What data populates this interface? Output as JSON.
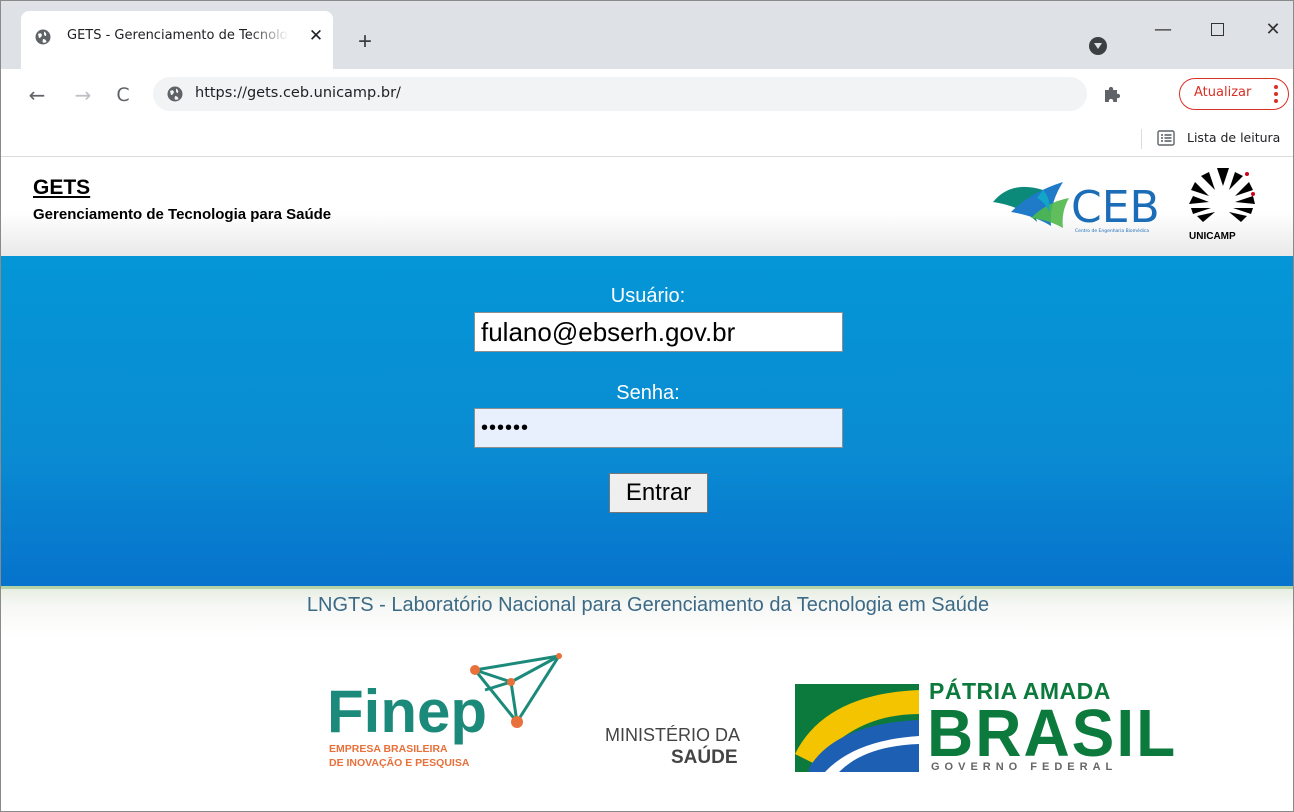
{
  "browser": {
    "tab": {
      "title": "GETS - Gerenciamento de Tecnologia para Saúde",
      "close": "✕"
    },
    "new_tab": "+",
    "window_controls": {
      "minimize": "—",
      "close": "✕"
    },
    "nav": {
      "back": "←",
      "forward": "→",
      "reload": "C"
    },
    "address": "https://gets.ceb.unicamp.br/",
    "update_button": "Atualizar",
    "reading_list": "Lista de leitura"
  },
  "header": {
    "title": "GETS",
    "subtitle": "Gerenciamento de Tecnologia para Saúde"
  },
  "login": {
    "user_label": "Usuário:",
    "user_value": "fulano@ebserh.gov.br",
    "password_label": "Senha:",
    "password_value": "••••••",
    "submit": "Entrar"
  },
  "footer": {
    "lab_text": "LNGTS - Laboratório Nacional para Gerenciamento da Tecnologia em Saúde",
    "logos": {
      "ceb": {
        "name": "CEB",
        "tagline": "Centro de Engenharia Biomédica"
      },
      "unicamp": "UNICAMP",
      "finep": {
        "name": "Finep",
        "line1": "EMPRESA BRASILEIRA",
        "line2": "DE INOVAÇÃO E PESQUISA"
      },
      "ministerio": {
        "line1": "MINISTÉRIO DA",
        "line2": "SAÚDE"
      },
      "governo": {
        "line1": "PÁTRIA AMADA",
        "line2": "BRASIL",
        "line3": "GOVERNO FEDERAL"
      }
    }
  },
  "colors": {
    "login_band": "#0a8bd2",
    "lab_text": "#3c6a86",
    "update_accent": "#d93025",
    "brasil_green": "#0c7a3c",
    "finep_teal": "#1b8a7a",
    "finep_orange": "#e8703a"
  }
}
